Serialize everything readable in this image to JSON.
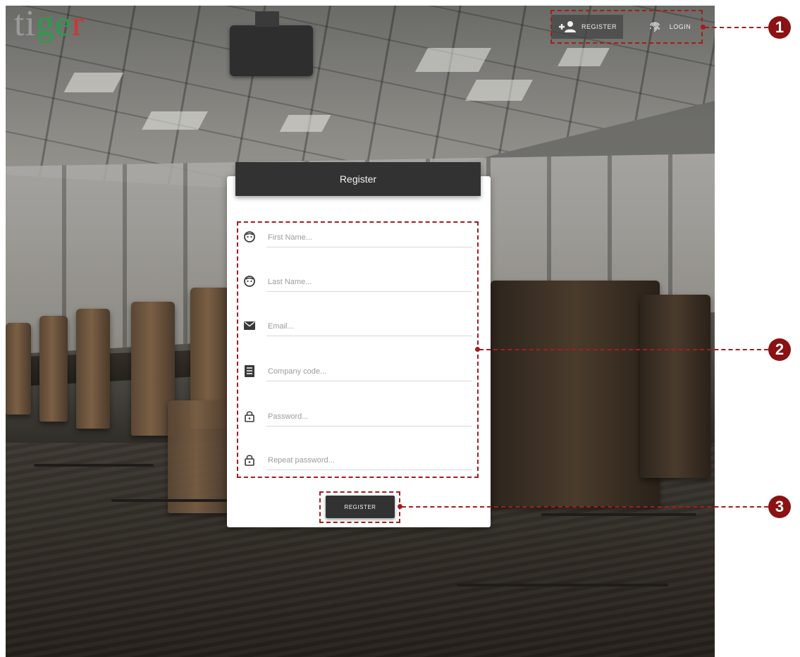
{
  "logo": {
    "letters": [
      "t",
      "i",
      "g",
      "e",
      "r"
    ],
    "colors": [
      "#9a9a9a",
      "#2e9a4e",
      "#c83a32"
    ]
  },
  "nav": {
    "register_label": "REGISTER",
    "login_label": "LOGIN"
  },
  "form": {
    "title": "Register",
    "fields": [
      {
        "icon": "face-icon",
        "placeholder": "First Name..."
      },
      {
        "icon": "face-icon",
        "placeholder": "Last Name..."
      },
      {
        "icon": "email-icon",
        "placeholder": "Email..."
      },
      {
        "icon": "receipt-icon",
        "placeholder": "Company code..."
      },
      {
        "icon": "lock-icon",
        "placeholder": "Password..."
      },
      {
        "icon": "lock-icon",
        "placeholder": "Repeat password..."
      }
    ],
    "submit_label": "REGISTER"
  },
  "callouts": [
    {
      "number": "1"
    },
    {
      "number": "2"
    },
    {
      "number": "3"
    }
  ],
  "colors": {
    "callout": "#a61c1c",
    "badge": "#8a1212",
    "header_dark": "#333232"
  }
}
